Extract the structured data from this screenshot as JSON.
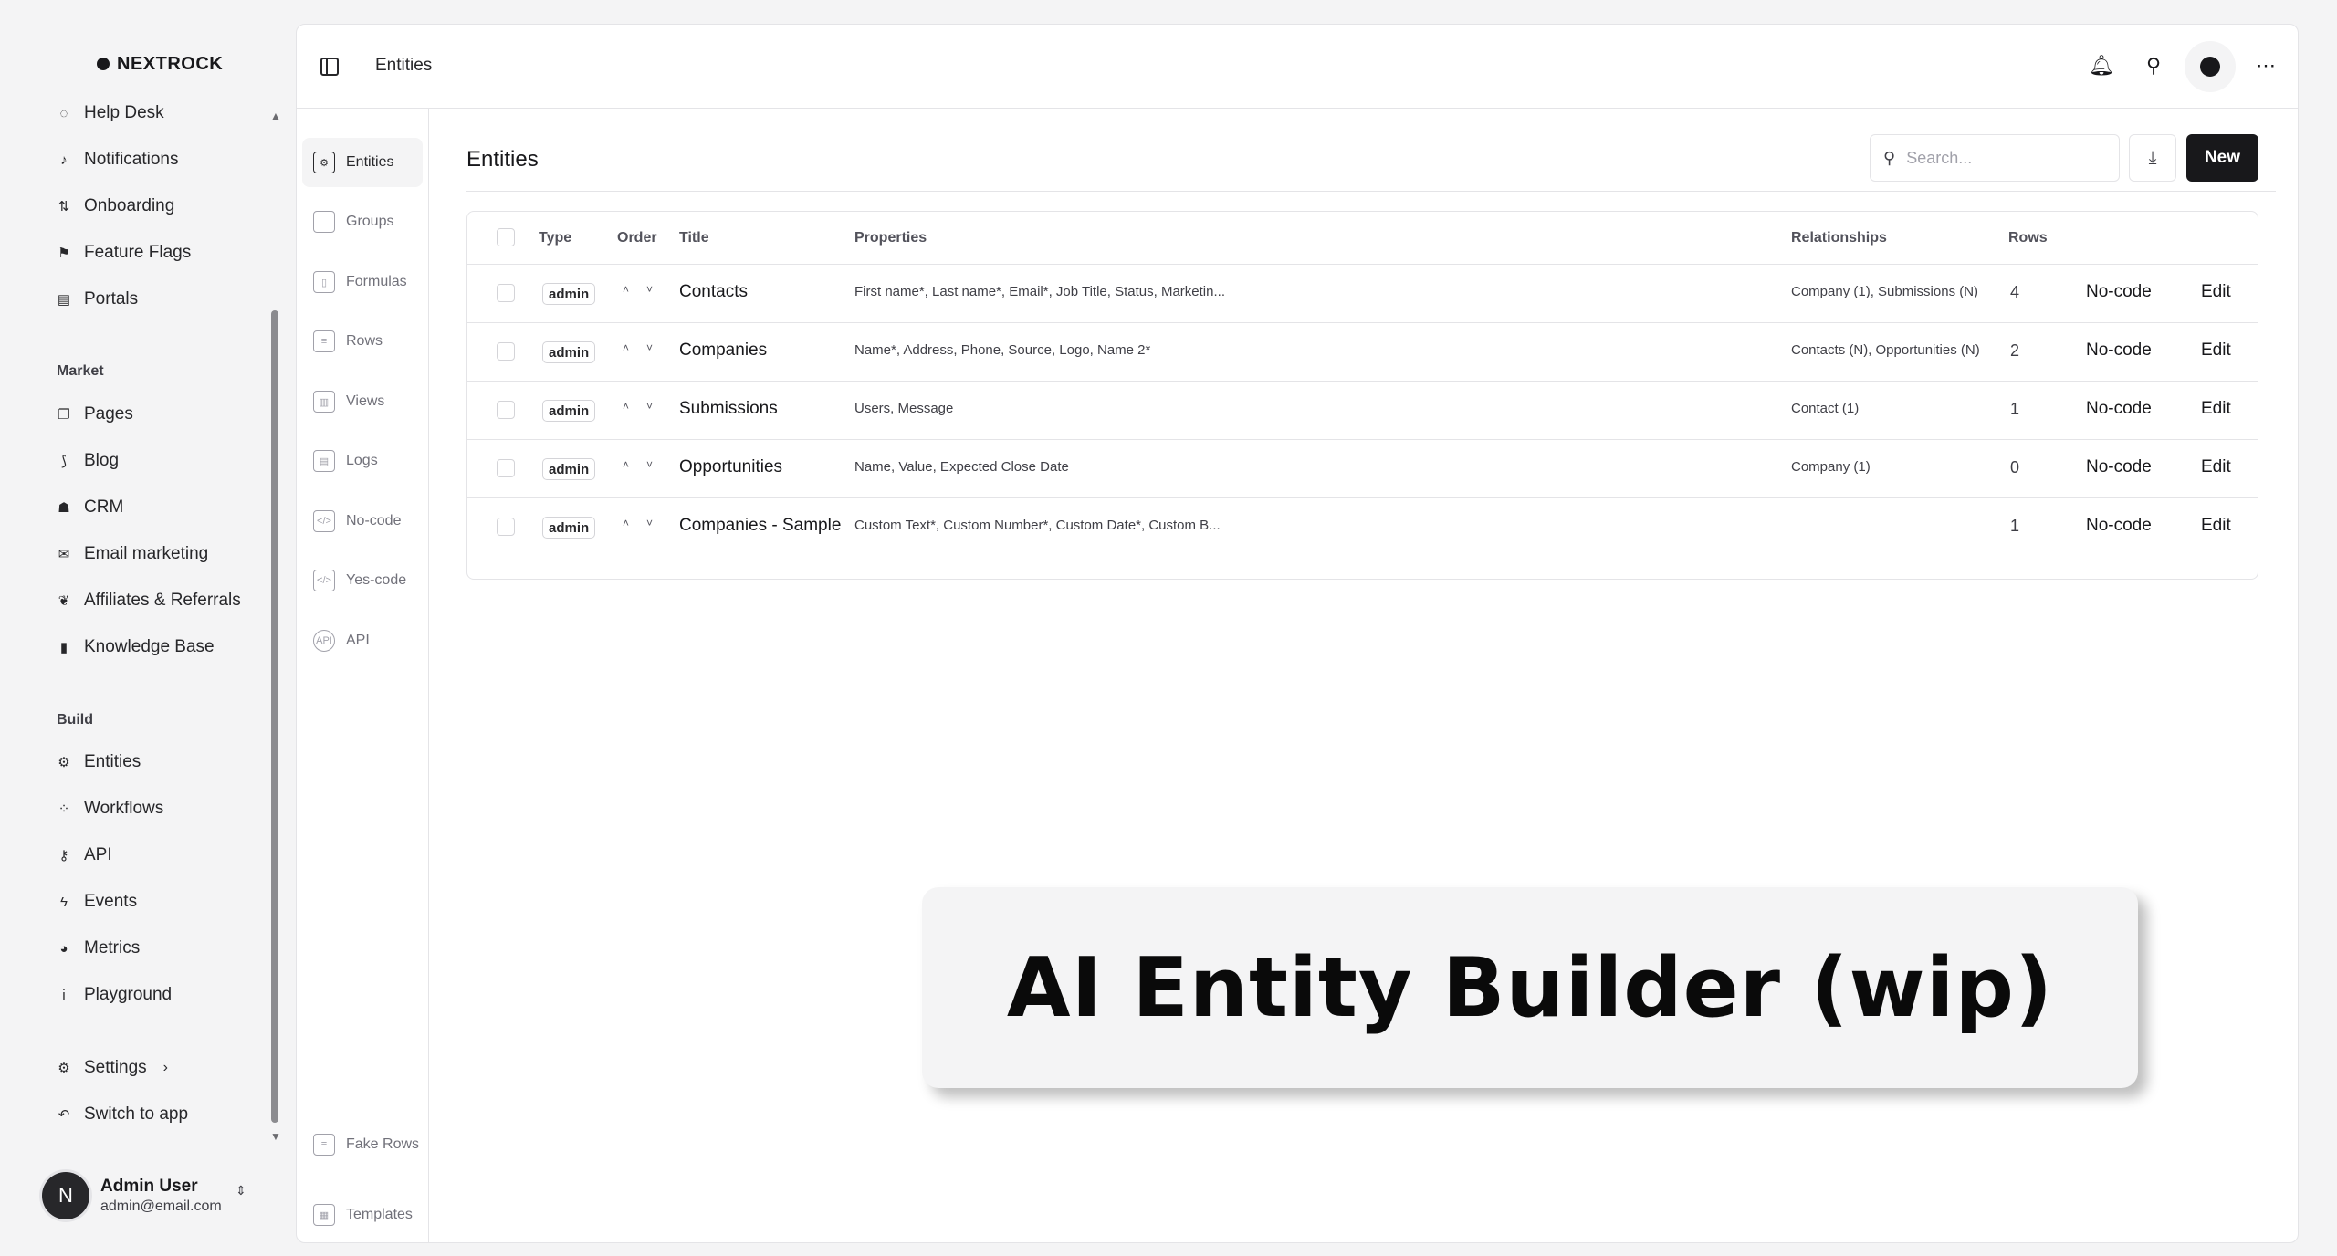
{
  "brand": {
    "name": "NEXTROCK"
  },
  "sidebar": {
    "top_items": [
      {
        "label": "Help Desk",
        "icon": "help-desk-icon"
      },
      {
        "label": "Notifications",
        "icon": "notifications-icon"
      },
      {
        "label": "Onboarding",
        "icon": "onboarding-icon"
      },
      {
        "label": "Feature Flags",
        "icon": "flag-icon"
      },
      {
        "label": "Portals",
        "icon": "portals-icon"
      }
    ],
    "market_title": "Market",
    "market_items": [
      {
        "label": "Pages",
        "icon": "pages-icon"
      },
      {
        "label": "Blog",
        "icon": "rss-icon"
      },
      {
        "label": "CRM",
        "icon": "crm-icon"
      },
      {
        "label": "Email marketing",
        "icon": "mail-icon"
      },
      {
        "label": "Affiliates & Referrals",
        "icon": "affiliates-icon"
      },
      {
        "label": "Knowledge Base",
        "icon": "book-icon"
      }
    ],
    "build_title": "Build",
    "build_items": [
      {
        "label": "Entities",
        "icon": "entities-icon"
      },
      {
        "label": "Workflows",
        "icon": "workflows-icon"
      },
      {
        "label": "API",
        "icon": "key-icon"
      },
      {
        "label": "Events",
        "icon": "bolt-icon"
      },
      {
        "label": "Metrics",
        "icon": "metrics-icon"
      },
      {
        "label": "Playground",
        "icon": "playground-icon"
      }
    ],
    "settings_label": "Settings",
    "switch_label": "Switch to app"
  },
  "user": {
    "initial": "N",
    "name": "Admin User",
    "email": "admin@email.com"
  },
  "topbar": {
    "breadcrumb": "Entities"
  },
  "subnav": {
    "items": [
      "Entities",
      "Groups",
      "Formulas",
      "Rows",
      "Views",
      "Logs",
      "No-code",
      "Yes-code",
      "API"
    ],
    "fake_rows": "Fake Rows",
    "templates": "Templates"
  },
  "page": {
    "title": "Entities",
    "search_placeholder": "Search...",
    "new_label": "New"
  },
  "table": {
    "headers": {
      "type": "Type",
      "order": "Order",
      "title": "Title",
      "properties": "Properties",
      "relationships": "Relationships",
      "rows": "Rows"
    },
    "rows": [
      {
        "type": "admin",
        "title": "Contacts",
        "properties": "First name*, Last name*, Email*, Job Title, Status, Marketin...",
        "relationships": "Company (1), Submissions (N)",
        "rows": "4",
        "nocode": "No-code",
        "edit": "Edit"
      },
      {
        "type": "admin",
        "title": "Companies",
        "properties": "Name*, Address, Phone, Source, Logo, Name 2*",
        "relationships": "Contacts (N), Opportunities (N)",
        "rows": "2",
        "nocode": "No-code",
        "edit": "Edit"
      },
      {
        "type": "admin",
        "title": "Submissions",
        "properties": "Users, Message",
        "relationships": "Contact (1)",
        "rows": "1",
        "nocode": "No-code",
        "edit": "Edit"
      },
      {
        "type": "admin",
        "title": "Opportunities",
        "properties": "Name, Value, Expected Close Date",
        "relationships": "Company (1)",
        "rows": "0",
        "nocode": "No-code",
        "edit": "Edit"
      },
      {
        "type": "admin",
        "title": "Companies - Sample",
        "properties": "Custom Text*, Custom Number*, Custom Date*, Custom B...",
        "relationships": "",
        "rows": "1",
        "nocode": "No-code",
        "edit": "Edit"
      }
    ]
  },
  "banner": {
    "text": "AI Entity Builder (wip)"
  }
}
